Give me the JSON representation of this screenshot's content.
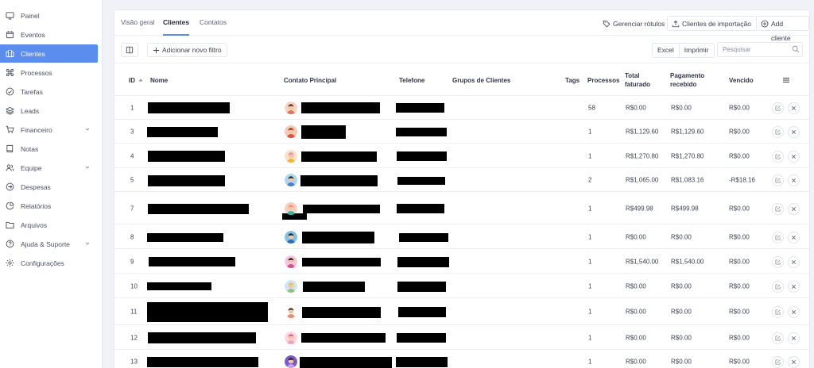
{
  "sidebar": {
    "items": [
      {
        "label": "Painel",
        "icon": "monitor-icon"
      },
      {
        "label": "Eventos",
        "icon": "calendar-icon"
      },
      {
        "label": "Clientes",
        "icon": "briefcase-icon",
        "active": true
      },
      {
        "label": "Processos",
        "icon": "command-icon"
      },
      {
        "label": "Tarefas",
        "icon": "check-circle-icon"
      },
      {
        "label": "Leads",
        "icon": "layers-icon"
      },
      {
        "label": "Financeiro",
        "icon": "cart-icon",
        "dropdown": true
      },
      {
        "label": "Notas",
        "icon": "book-icon"
      },
      {
        "label": "Equipe",
        "icon": "users-icon",
        "dropdown": true
      },
      {
        "label": "Despesas",
        "icon": "arrow-circle-icon"
      },
      {
        "label": "Relatórios",
        "icon": "pie-chart-icon"
      },
      {
        "label": "Arquivos",
        "icon": "folder-icon"
      },
      {
        "label": "Ajuda & Suporte",
        "icon": "help-circle-icon",
        "dropdown": true
      },
      {
        "label": "Configurações",
        "icon": "settings-icon"
      }
    ]
  },
  "tabs": {
    "overview": "Visão geral",
    "clients": "Clientes",
    "contacts": "Contatos"
  },
  "actions": {
    "manage_tags": "Gerenciar rótulos",
    "import_clients": "Clientes de importação",
    "add_client": "Add cliente"
  },
  "toolbar": {
    "add_filter": "Adicionar novo filtro",
    "excel": "Excel",
    "print": "Imprimir",
    "search_placeholder": "Pesquisar"
  },
  "table": {
    "headers": {
      "id": "ID",
      "name": "Nome",
      "contact": "Contato Principal",
      "phone": "Telefone",
      "groups": "Grupos de Clientes",
      "tags": "Tags",
      "processes": "Processos",
      "billed_1": "Total",
      "billed_2": "faturado",
      "received_1": "Pagamento",
      "received_2": "recebido",
      "due": "Vencido"
    },
    "rows": [
      {
        "id": "1",
        "processes": "58",
        "billed": "R$0.00",
        "received": "R$0.00",
        "due": "R$0.00"
      },
      {
        "id": "3",
        "processes": "1",
        "billed": "R$1,129.60",
        "received": "R$1,129.60",
        "due": "R$0.00"
      },
      {
        "id": "4",
        "processes": "1",
        "billed": "R$1,270.80",
        "received": "R$1,270.80",
        "due": "R$0.00"
      },
      {
        "id": "5",
        "processes": "2",
        "billed": "R$1,065.00",
        "received": "R$1,083.16",
        "due": "-R$18.16"
      },
      {
        "id": "7",
        "processes": "1",
        "billed": "R$499.98",
        "received": "R$499.98",
        "due": "R$0.00"
      },
      {
        "id": "8",
        "processes": "1",
        "billed": "R$0.00",
        "received": "R$0.00",
        "due": "R$0.00"
      },
      {
        "id": "9",
        "processes": "1",
        "billed": "R$1,540.00",
        "received": "R$1,540.00",
        "due": "R$0.00"
      },
      {
        "id": "10",
        "processes": "1",
        "billed": "R$0.00",
        "received": "R$0.00",
        "due": "R$0.00"
      },
      {
        "id": "11",
        "processes": "1",
        "billed": "R$0.00",
        "received": "R$0.00",
        "due": "R$0.00"
      },
      {
        "id": "12",
        "processes": "1",
        "billed": "R$0.00",
        "received": "R$0.00",
        "due": "R$0.00"
      },
      {
        "id": "13",
        "processes": "1",
        "billed": "R$0.00",
        "received": "R$0.00",
        "due": "R$0.00"
      }
    ]
  },
  "colors": {
    "accent": "#5b8def",
    "background": "#f0f2f8",
    "panel": "#ffffff",
    "border": "#eceef3",
    "redaction": "#000000"
  }
}
